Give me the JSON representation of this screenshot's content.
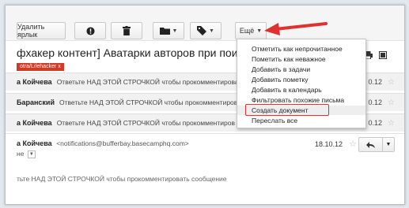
{
  "toolbar": {
    "remove_label": "Удалить ярлык",
    "more_label": "Ещё"
  },
  "thread": {
    "subject": "фхакер контент] Аватарки авторов при поиске в G",
    "label": "otra/Lifehacker  x"
  },
  "messages": [
    {
      "sender": "а Койчева",
      "snippet": "Ответьте НАД ЭТОЙ СТРОЧКОЙ чтобы прокомментировать",
      "date": "0.12"
    },
    {
      "sender": "Баранский",
      "snippet": "Ответьте НАД ЭТОЙ СТРОЧКОЙ чтобы прокомментиров",
      "date": "0.12"
    },
    {
      "sender": "а Койчева",
      "snippet": "Ответьте НАД ЭТОЙ СТРОЧКОЙ чтобы прокомментиров",
      "date": "0.12"
    }
  ],
  "expanded": {
    "sender": "а Койчева",
    "email": "<notifications@bufferbay.basecamphq.com>",
    "date": "18.10.12",
    "to_fragment": "не",
    "body": "тьте НАД ЭТОЙ СТРОЧКОЙ чтобы прокомментировать сообщение"
  },
  "menu": {
    "items": [
      "Отметить как непрочитанное",
      "Пометить как неважное",
      "Добавить в задачи",
      "Добавить пометку",
      "Добавить в календарь",
      "Фильтровать похожие письма",
      "Создать документ",
      "Переслать все"
    ],
    "highlighted_index": 6
  },
  "icons": {
    "important": "important-icon",
    "trash": "trash-icon",
    "folder": "folder-icon",
    "label": "tag-icon",
    "print": "print-icon",
    "new_window": "new-window-icon",
    "star": "star-icon",
    "reply": "reply-icon",
    "annotation_arrow": "red-arrow"
  },
  "colors": {
    "annotation": "#e03030",
    "label_chip": "#d13a25"
  }
}
